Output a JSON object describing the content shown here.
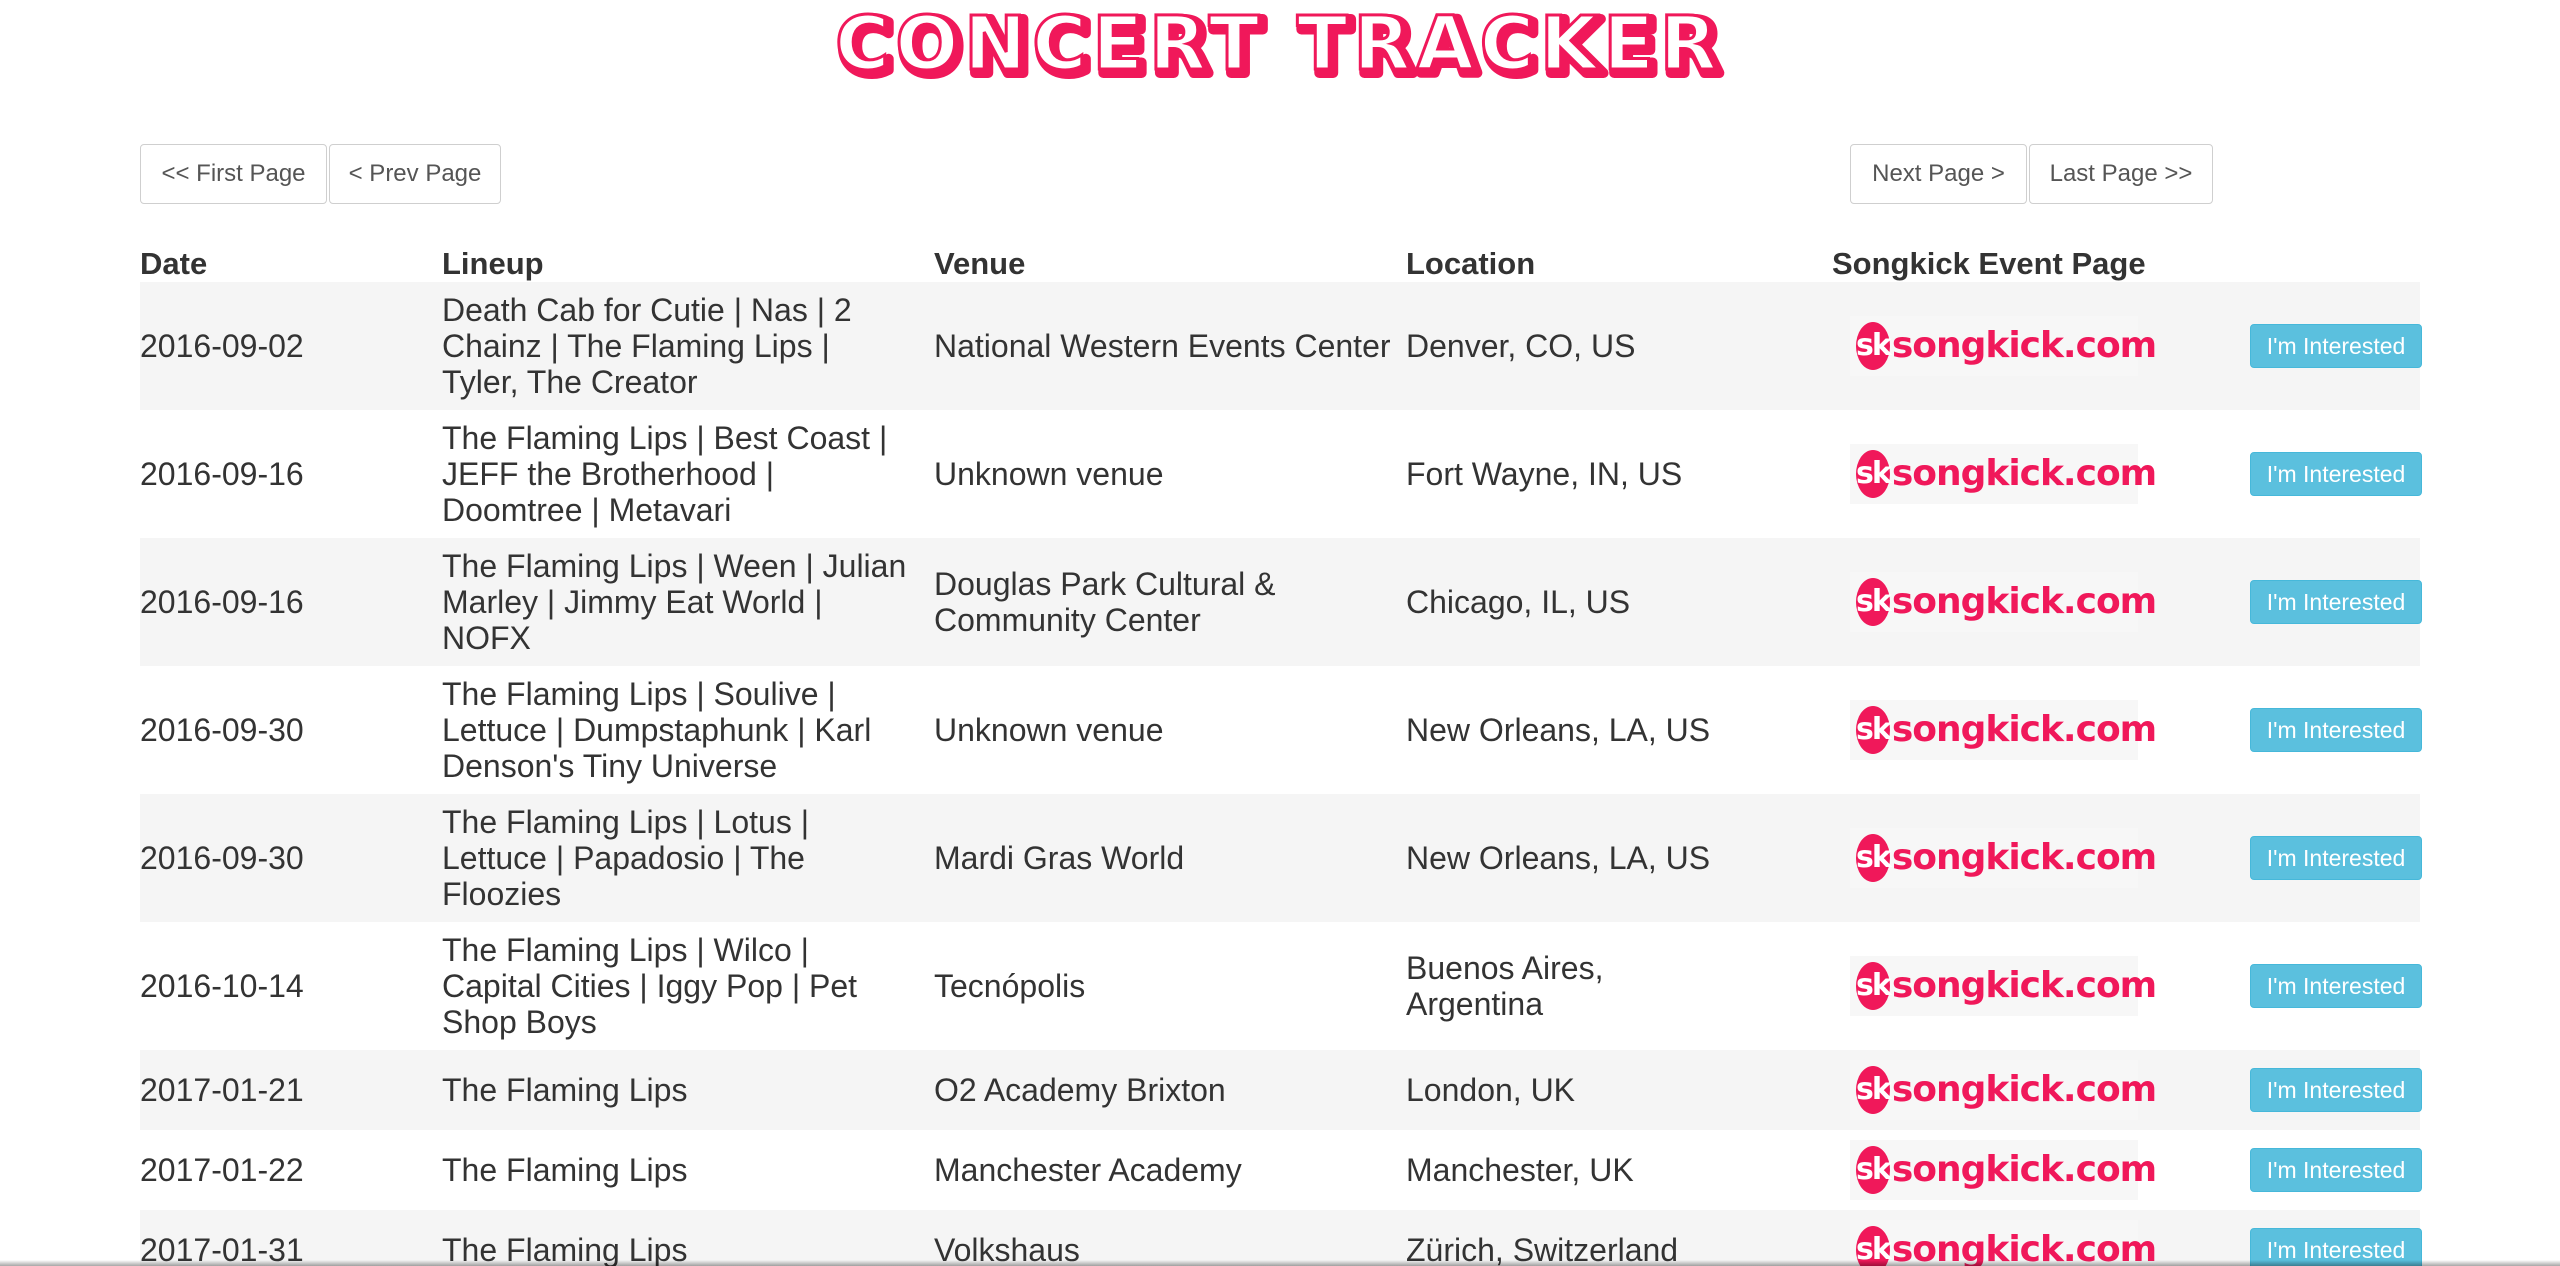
{
  "header": {
    "title": "CONCERT TRACKER"
  },
  "pagination": {
    "first_label": "<< First Page",
    "prev_label": "< Prev Page",
    "next_label": "Next Page >",
    "last_label": "Last Page >>"
  },
  "table": {
    "columns": [
      "Date",
      "Lineup",
      "Venue",
      "Location",
      "Songkick Event Page"
    ],
    "songkick_logo": {
      "badge": "sk",
      "text": "songkick.com"
    },
    "interested_label": "I'm Interested",
    "rows": [
      {
        "date": "2016-09-02",
        "lineup": "Death Cab for Cutie | Nas | 2 Chainz | The Flaming Lips | Tyler, The Creator",
        "venue": "National Western Events Center",
        "location": "Denver, CO, US"
      },
      {
        "date": "2016-09-16",
        "lineup": "The Flaming Lips | Best Coast | JEFF the Brotherhood | Doomtree | Metavari",
        "venue": "Unknown venue",
        "location": "Fort Wayne, IN, US"
      },
      {
        "date": "2016-09-16",
        "lineup": "The Flaming Lips | Ween | Julian Marley | Jimmy Eat World | NOFX",
        "venue": "Douglas Park Cultural & Community Center",
        "location": "Chicago, IL, US"
      },
      {
        "date": "2016-09-30",
        "lineup": "The Flaming Lips | Soulive | Lettuce | Dumpstaphunk | Karl Denson's Tiny Universe",
        "venue": "Unknown venue",
        "location": "New Orleans, LA, US"
      },
      {
        "date": "2016-09-30",
        "lineup": "The Flaming Lips | Lotus | Lettuce | Papadosio | The Floozies",
        "venue": "Mardi Gras World",
        "location": "New Orleans, LA, US"
      },
      {
        "date": "2016-10-14",
        "lineup": "The Flaming Lips | Wilco | Capital Cities | Iggy Pop | Pet Shop Boys",
        "venue": "Tecnópolis",
        "location": "Buenos Aires, Argentina"
      },
      {
        "date": "2017-01-21",
        "lineup": "The Flaming Lips",
        "venue": "O2 Academy Brixton",
        "location": "London, UK"
      },
      {
        "date": "2017-01-22",
        "lineup": "The Flaming Lips",
        "venue": "Manchester Academy",
        "location": "Manchester, UK"
      },
      {
        "date": "2017-01-31",
        "lineup": "The Flaming Lips",
        "venue": "Volkshaus",
        "location": "Zürich, Switzerland"
      }
    ]
  },
  "colors": {
    "title": "#f0185a",
    "songkick": "#f0185a",
    "interested_button": "#5bc0de",
    "row_alt": "#f5f5f5"
  }
}
